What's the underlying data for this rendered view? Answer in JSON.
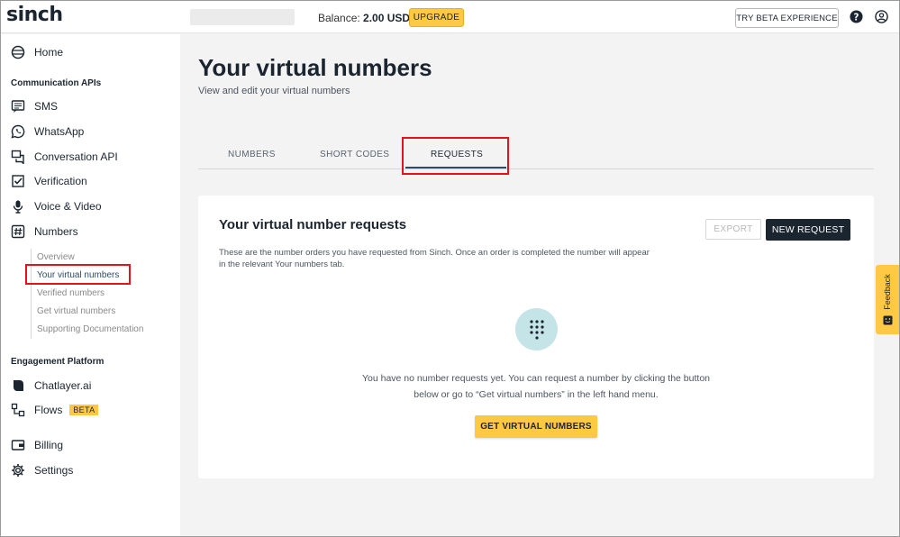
{
  "header": {
    "logo": "sinch",
    "balance_label": "Balance:",
    "balance_value": "2.00 USD",
    "upgrade_label": "UPGRADE",
    "beta_label": "TRY BETA EXPERIENCE",
    "help_icon": "help-circle-icon",
    "account_icon": "user-circle-icon"
  },
  "sidebar": {
    "home": "Home",
    "communication_title": "Communication APIs",
    "sms": "SMS",
    "whatsapp": "WhatsApp",
    "conversation": "Conversation API",
    "verification": "Verification",
    "voice": "Voice & Video",
    "numbers": "Numbers",
    "numbers_sub": [
      "Overview",
      "Your virtual numbers",
      "Verified numbers",
      "Get virtual numbers",
      "Supporting Documentation"
    ],
    "engagement_title": "Engagement Platform",
    "chatlayer": "Chatlayer.ai",
    "flows": "Flows",
    "flows_badge": "BETA",
    "billing": "Billing",
    "settings": "Settings"
  },
  "main": {
    "title": "Your virtual numbers",
    "subtitle": "View and edit your virtual numbers",
    "tabs": [
      "NUMBERS",
      "SHORT CODES",
      "REQUESTS"
    ],
    "active_tab": "REQUESTS",
    "card": {
      "title": "Your virtual number requests",
      "description": "These are the number orders you have requested from Sinch. Once an order is completed the number will appear in the relevant Your numbers tab.",
      "export_label": "EXPORT",
      "new_request_label": "NEW REQUEST",
      "empty_line1": "You have no number requests yet. You can request a number by clicking the button",
      "empty_line2": "below or go to “Get virtual numbers” in the left hand menu.",
      "get_numbers_label": "GET VIRTUAL NUMBERS"
    }
  },
  "feedback": {
    "label": "Feedback"
  },
  "colors": {
    "accent": "#ffc845",
    "dark": "#1b2530",
    "highlight": "#e3121c",
    "active_link": "#2b4b6f"
  }
}
